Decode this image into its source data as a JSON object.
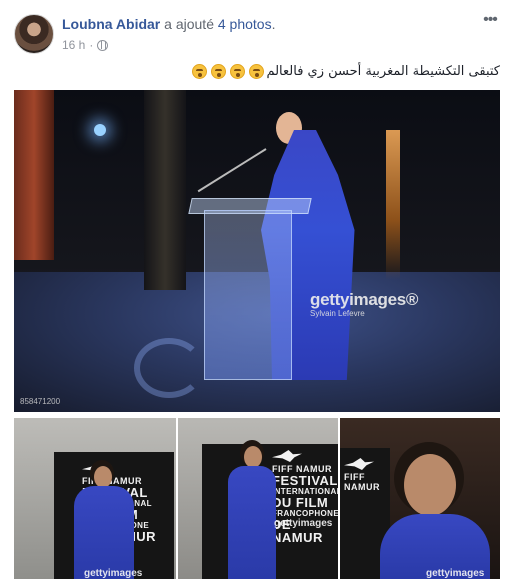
{
  "post": {
    "author": "Loubna Abidar",
    "action_prefix": "a ajouté",
    "action_count": "4 photos",
    "action_suffix": ".",
    "timestamp": "16 h",
    "dot": "·",
    "privacy_icon": "globe-icon",
    "more_icon": "more-options-icon",
    "more_glyph": "•••",
    "caption": "كتبقى التكشيطة المغربية أحسن زي فالعالم",
    "caption_emoji_count": 4
  },
  "photos": {
    "main": {
      "watermark_brand": "gettyimages®",
      "watermark_credit": "Sylvain Lefevre",
      "photo_id": "858471200"
    },
    "thumb1": {
      "banner_fiff": "FIFF NAMUR",
      "banner_lines": [
        "FESTIVAL",
        "INTERNATIONAL",
        "DU FILM",
        "FRANCOPHONE",
        "DE NAMUR"
      ],
      "watermark": "gettyimages"
    },
    "thumb2": {
      "banner_fiff": "FIFF NAMUR",
      "banner_lines": [
        "FESTIVAL",
        "INTERNATIONAL",
        "DU FILM",
        "FRANCOPHONE",
        "DE NAMUR"
      ],
      "watermark": "gettyimages"
    },
    "thumb3": {
      "banner_fiff": "FIFF NAMUR",
      "watermark": "gettyimages"
    }
  }
}
